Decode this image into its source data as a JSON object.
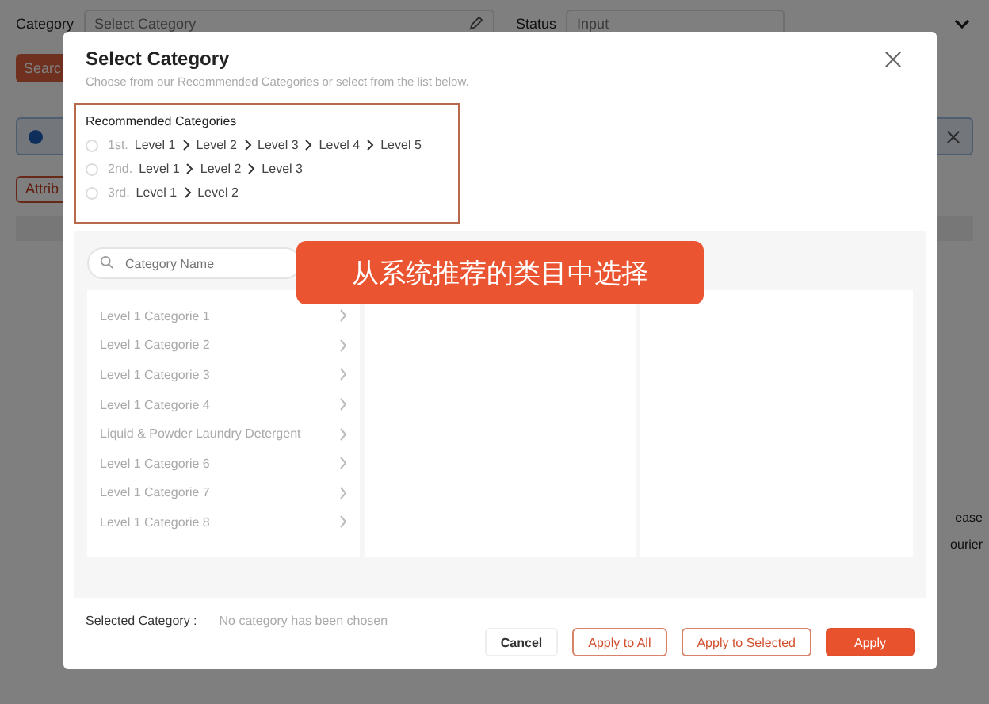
{
  "background_page": {
    "filters": [
      {
        "label": "Category",
        "placeholder": "Select Category"
      },
      {
        "label": "Status",
        "placeholder": "Input"
      }
    ],
    "search_button": "Searc",
    "attribute_button": "Attrib",
    "side_texts": [
      "ease",
      "ourier"
    ]
  },
  "dialog": {
    "title": "Select Category",
    "subtitle": "Choose from our Recommended Categories or select from the list below.",
    "recommended": {
      "heading": "Recommended Categories",
      "options": [
        {
          "rank": "1st.",
          "path": [
            "Level 1",
            "Level 2",
            "Level 3",
            "Level 4",
            "Level 5"
          ],
          "selected": false
        },
        {
          "rank": "2nd.",
          "path": [
            "Level 1",
            "Level 2",
            "Level 3"
          ],
          "selected": false
        },
        {
          "rank": "3rd.",
          "path": [
            "Level 1",
            "Level 2"
          ],
          "selected": false
        }
      ]
    },
    "search": {
      "placeholder": "Category Name"
    },
    "category_list": [
      "Level 1 Categorie 1",
      "Level 1 Categorie 2",
      "Level 1 Categorie 3",
      "Level 1 Categorie 4",
      "Liquid & Powder Laundry Detergent",
      "Level 1 Categorie 6",
      "Level 1 Categorie 7",
      "Level 1 Categorie 8"
    ],
    "selected_category": {
      "label": "Selected Category :",
      "value": "No category has been chosen"
    },
    "buttons": [
      {
        "label": "Cancel",
        "kind": "default"
      },
      {
        "label": "Apply to All",
        "kind": "outline"
      },
      {
        "label": "Apply to Selected",
        "kind": "outline"
      },
      {
        "label": "Apply",
        "kind": "primary"
      }
    ]
  },
  "callout": "从系统推荐的类目中选择"
}
